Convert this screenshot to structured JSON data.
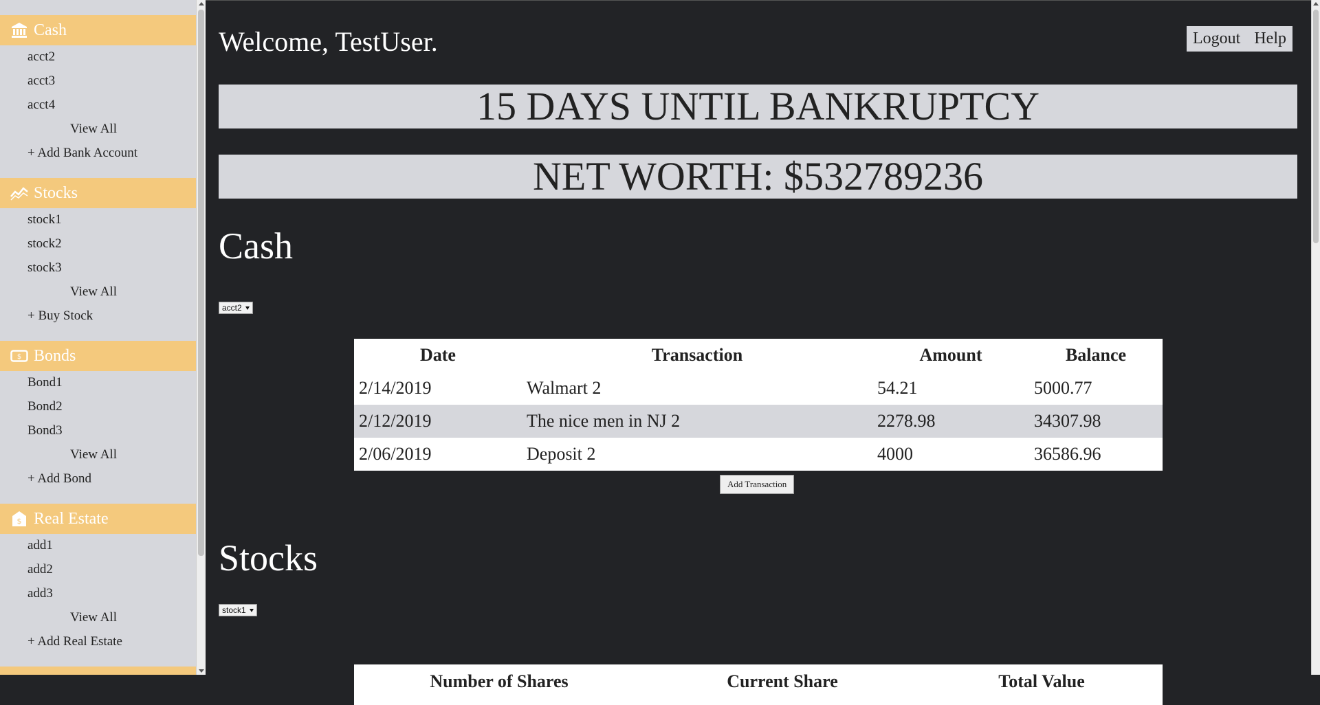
{
  "sidebar": {
    "sections": [
      {
        "title": "Cash",
        "icon": "bank-icon",
        "items": [
          "acct2",
          "acct3",
          "acct4"
        ],
        "view_all": "View All",
        "add": "+ Add Bank Account"
      },
      {
        "title": "Stocks",
        "icon": "chart-line-icon",
        "items": [
          "stock1",
          "stock2",
          "stock3"
        ],
        "view_all": "View All",
        "add": "+ Buy Stock"
      },
      {
        "title": "Bonds",
        "icon": "bill-icon",
        "items": [
          "Bond1",
          "Bond2",
          "Bond3"
        ],
        "view_all": "View All",
        "add": "+ Add Bond"
      },
      {
        "title": "Real Estate",
        "icon": "house-dollar-icon",
        "items": [
          "add1",
          "add2",
          "add3"
        ],
        "view_all": "View All",
        "add": "+ Add Real Estate"
      }
    ]
  },
  "header": {
    "welcome": "Welcome, TestUser.",
    "logout": "Logout",
    "help": "Help"
  },
  "banners": {
    "bankruptcy": "15 DAYS UNTIL BANKRUPTCY",
    "net_worth": "NET WORTH: $532789236"
  },
  "cash": {
    "title": "Cash",
    "selected_account": "acct2",
    "columns": [
      "Date",
      "Transaction",
      "Amount",
      "Balance"
    ],
    "rows": [
      [
        "2/14/2019",
        "Walmart 2",
        "54.21",
        "5000.77"
      ],
      [
        "2/12/2019",
        "The nice men in NJ 2",
        "2278.98",
        "34307.98"
      ],
      [
        "2/06/2019",
        "Deposit 2",
        "4000",
        "36586.96"
      ]
    ],
    "add_button": "Add Transaction"
  },
  "stocks": {
    "title": "Stocks",
    "selected_stock": "stock1",
    "columns": [
      "Number of Shares",
      "Current Share",
      "Total Value"
    ]
  },
  "colors": {
    "sidebar_bg": "#d6d7dc",
    "section_header": "#f4c97d",
    "main_bg": "#222326"
  }
}
